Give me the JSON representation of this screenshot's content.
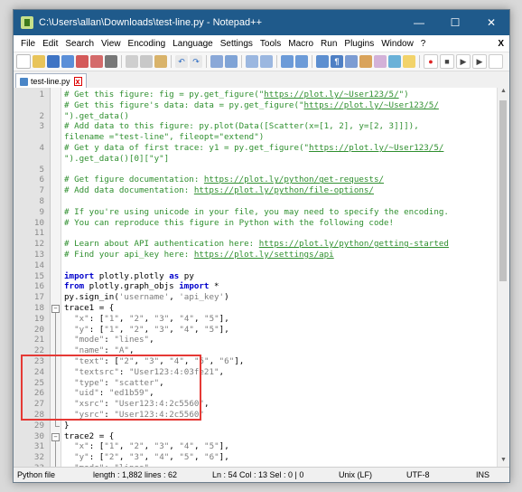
{
  "window": {
    "title": "C:\\Users\\allan\\Downloads\\test-line.py - Notepad++",
    "minimize": "—",
    "maximize": "☐",
    "close": "✕"
  },
  "menubar": {
    "items": [
      "File",
      "Edit",
      "Search",
      "View",
      "Encoding",
      "Language",
      "Settings",
      "Tools",
      "Macro",
      "Run",
      "Plugins",
      "Window",
      "?"
    ],
    "close_label": "X"
  },
  "tab": {
    "label": "test-line.py"
  },
  "editor": {
    "line_numbers": [
      "1",
      "",
      "2",
      "3",
      "",
      "4",
      "",
      "5",
      "6",
      "7",
      "8",
      "9",
      "10",
      "11",
      "12",
      "13",
      "14",
      "15",
      "16",
      "17",
      "18",
      "19",
      "20",
      "21",
      "22",
      "23",
      "24",
      "25",
      "26",
      "27",
      "28",
      "29",
      "30",
      "31",
      "32",
      "33"
    ],
    "lines": [
      "# Get this figure: fig = py.get_figure(\"https://plot.ly/~User123/5/\")",
      "# Get this figure's data: data = py.get_figure(\"https://plot.ly/~User123/5/",
      "\").get_data()",
      "# Add data to this figure: py.plot(Data([Scatter(x=[1, 2], y=[2, 3]]]),",
      "filename =\"test-line\", fileopt=\"extend\")",
      "# Get y data of first trace: y1 = py.get_figure(\"https://plot.ly/~User123/5/",
      "\").get_data()[0][\"y\"]",
      "",
      "# Get figure documentation: https://plot.ly/python/get-requests/",
      "# Add data documentation: https://plot.ly/python/file-options/",
      "",
      "# If you're using unicode in your file, you may need to specify the encoding.",
      "# You can reproduce this figure in Python with the following code!",
      "",
      "# Learn about API authentication here: https://plot.ly/python/getting-started",
      "# Find your api_key here: https://plot.ly/settings/api",
      "",
      "import plotly.plotly as py",
      "from plotly.graph_objs import *",
      "py.sign_in('username', 'api_key')",
      "trace1 = {",
      "  \"x\": [\"1\", \"2\", \"3\", \"4\", \"5\"],",
      "  \"y\": [\"1\", \"2\", \"3\", \"4\", \"5\"],",
      "  \"mode\": \"lines\",",
      "  \"name\": \"A\",",
      "  \"text\": [\"2\", \"3\", \"4\", \"5\", \"6\"],",
      "  \"textsrc\": \"User123:4:03fe21\",",
      "  \"type\": \"scatter\",",
      "  \"uid\": \"ed1b59\",",
      "  \"xsrc\": \"User123:4:2c5560\",",
      "  \"ysrc\": \"User123:4:2c5560\"",
      "}",
      "trace2 = {",
      "  \"x\": [\"1\", \"2\", \"3\", \"4\", \"5\"],",
      "  \"y\": [\"2\", \"3\", \"4\", \"5\", \"6\"],",
      "  \"mode\": \"lines\","
    ]
  },
  "statusbar": {
    "file_type": "Python file",
    "length_lines": "length : 1,882   lines : 62",
    "position": "Ln : 54   Col : 13   Sel : 0 | 0",
    "eol": "Unix (LF)",
    "encoding": "UTF-8",
    "mode": "INS"
  },
  "colors": {
    "titlebar": "#1f5a8b",
    "comment": "#2f8f2f",
    "keyword": "#0000cc",
    "string": "#7c7c7c",
    "highlight": "#e53935"
  }
}
